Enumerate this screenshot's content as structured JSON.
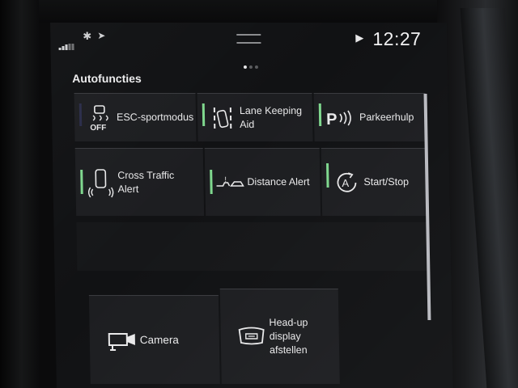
{
  "statusbar": {
    "clock": "12:27",
    "icons": [
      "signal-icon",
      "bluetooth-icon",
      "location-icon",
      "play-icon"
    ]
  },
  "page": {
    "title": "Autofuncties",
    "pager": {
      "current": 1,
      "total": 3
    }
  },
  "tiles": [
    {
      "label": "ESC-sportmodus",
      "icon": "esc-off-icon",
      "active": false
    },
    {
      "label": "Lane Keeping Aid",
      "icon": "lane-keeping-icon",
      "active": true
    },
    {
      "label": "Parkeerhulp",
      "icon": "park-assist-icon",
      "active": true
    },
    {
      "label": "Cross Traffic Alert",
      "icon": "cross-traffic-icon",
      "active": true
    },
    {
      "label": "Distance Alert",
      "icon": "distance-alert-icon",
      "active": true
    },
    {
      "label": "Start/Stop",
      "icon": "start-stop-icon",
      "active": true
    },
    {
      "label": "Camera",
      "icon": "camera-icon",
      "active": false
    },
    {
      "label": "Head-up display afstellen",
      "icon": "head-up-display-icon",
      "active": false
    }
  ],
  "colors": {
    "indicator_on": "#7fd88e",
    "indicator_off": "#2b2d4a",
    "tile_bg": "#1d1e21",
    "screen_bg": "#111214"
  }
}
